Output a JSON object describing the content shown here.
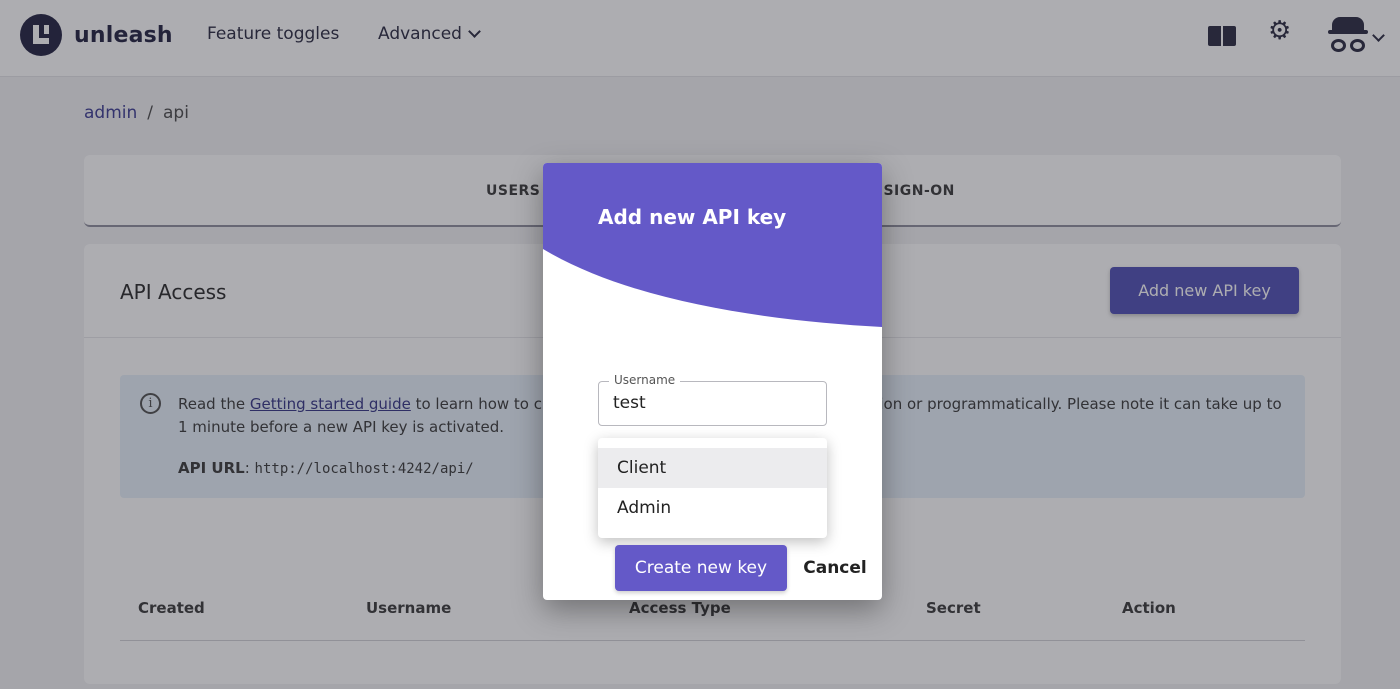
{
  "app": {
    "name": "unleash"
  },
  "nav": {
    "feature_toggles": "Feature toggles",
    "advanced": "Advanced"
  },
  "breadcrumb": {
    "parent": "admin",
    "separator": "/",
    "current": "api"
  },
  "tabs": {
    "users": "USERS",
    "sso": "E SIGN-ON"
  },
  "api_access": {
    "title": "API Access",
    "add_button": "Add new API key",
    "info_prefix": "Read the ",
    "info_link": "Getting started guide",
    "info_mid": " to learn how to c",
    "info_rest": "ution or programmatically. Please note it can take up to 1 minute before a new API key is activated.",
    "api_url_label": "API URL",
    "api_url": "http://localhost:4242/api/"
  },
  "table": {
    "headers": [
      "Created",
      "Username",
      "Access Type",
      "Secret",
      "Action"
    ]
  },
  "modal": {
    "title": "Add new API key",
    "username_label": "Username",
    "username_value": "test",
    "options": [
      "Client",
      "Admin"
    ],
    "selected_option": "Client",
    "create_button": "Create new key",
    "cancel_button": "Cancel"
  },
  "colors": {
    "brand_dark": "#1a1a3a",
    "primary": "#6459c8",
    "info_bg": "#e6f1fa"
  }
}
